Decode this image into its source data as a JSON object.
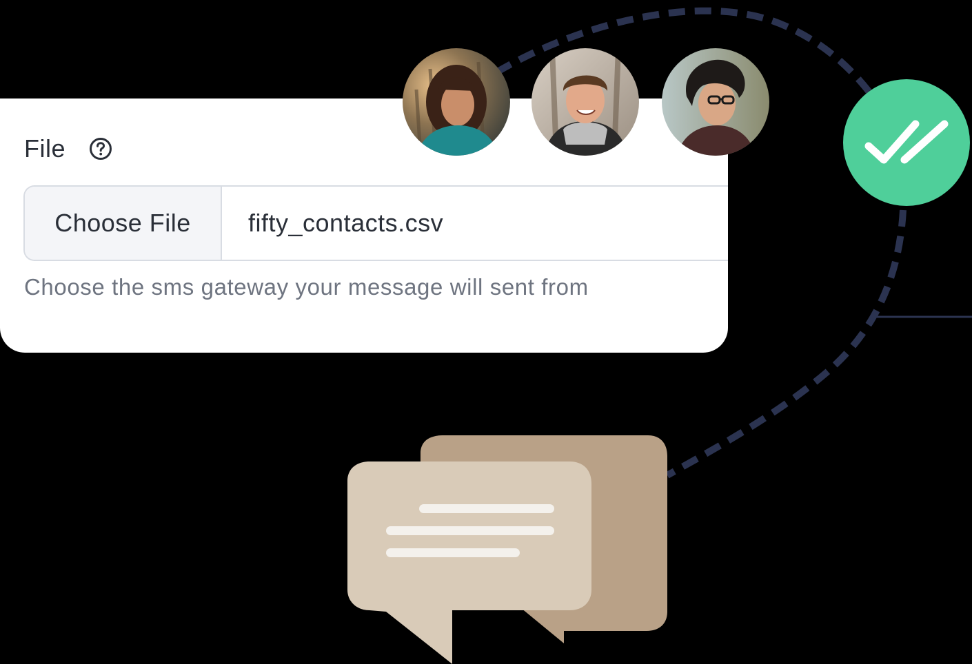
{
  "file_field": {
    "label": "File",
    "choose_button_label": "Choose File",
    "selected_file": "fifty_contacts.csv",
    "help_text": "Choose the sms gateway your message will sent from"
  },
  "recipients": [
    {
      "name": "avatar-1"
    },
    {
      "name": "avatar-2"
    },
    {
      "name": "avatar-3"
    }
  ],
  "icons": {
    "help": "question-circle-icon",
    "delivered": "double-check-icon",
    "message": "chat-bubbles-icon"
  },
  "colors": {
    "background": "#000000",
    "card": "#ffffff",
    "connector": "#2b3350",
    "success": "#4fcf9a",
    "bubble_back": "#b9a187",
    "bubble_front": "#d9cbb8"
  }
}
